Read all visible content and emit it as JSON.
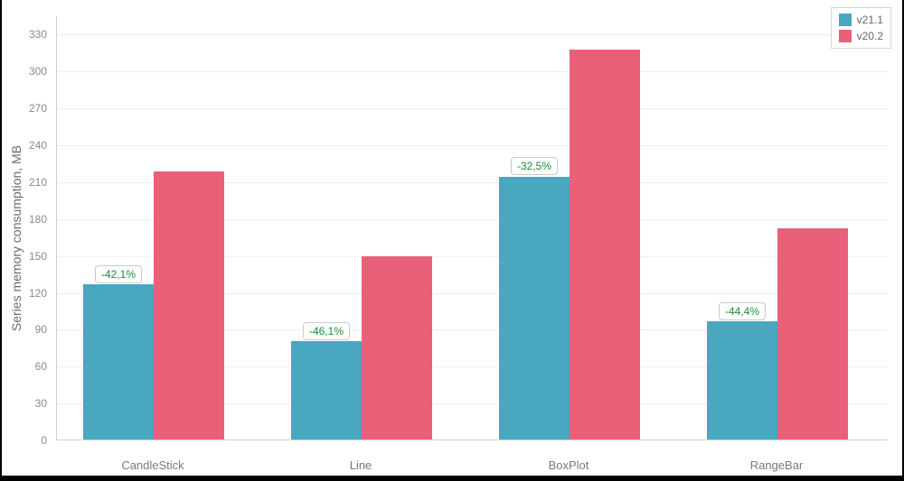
{
  "chart_data": {
    "type": "bar",
    "title": "",
    "xlabel": "",
    "ylabel": "Series memory consumption, MB",
    "ylim": [
      0,
      345
    ],
    "yticks": [
      0,
      30,
      60,
      90,
      120,
      150,
      180,
      210,
      240,
      270,
      300,
      330
    ],
    "categories": [
      "CandleStick",
      "Line",
      "BoxPlot",
      "RangeBar"
    ],
    "series": [
      {
        "name": "v21.1",
        "color": "#49a7bf",
        "values": [
          126,
          80,
          214,
          96
        ]
      },
      {
        "name": "v20.2",
        "color": "#e96179",
        "values": [
          218,
          149,
          317,
          172
        ]
      }
    ],
    "value_labels": {
      "v21.1": [
        "126MB",
        "80MB",
        "214MB",
        "96MB"
      ],
      "v20.2": [
        "218MB",
        "149MB",
        "317MB",
        "172MB"
      ]
    },
    "delta_labels": [
      "-42,1%",
      "-46,1%",
      "-32,5%",
      "-44,4%"
    ]
  }
}
